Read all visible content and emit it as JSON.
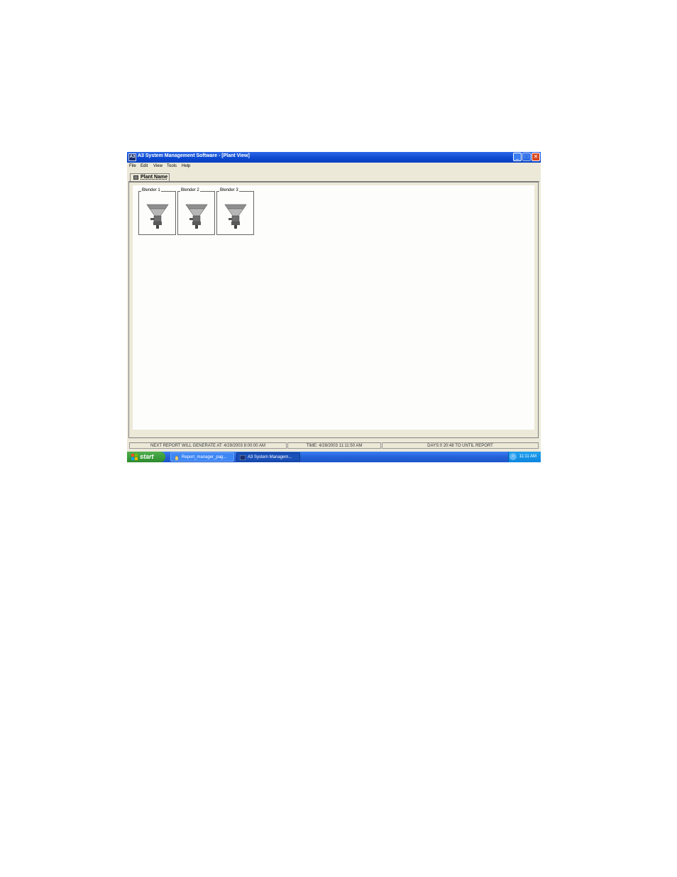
{
  "window": {
    "app_icon_text": "A3",
    "title": "A3 System Management Software - [Plant View]",
    "minimize_glyph": "_",
    "maximize_glyph": "□",
    "close_glyph": "✕"
  },
  "menu": [
    "File",
    "Edit",
    "View",
    "Tools",
    "Help"
  ],
  "tabs": [
    {
      "label": "Plant Name",
      "icon": "plant-icon"
    }
  ],
  "blenders": [
    {
      "label": "Blender 1",
      "icon": "blender-icon"
    },
    {
      "label": "Blender 2",
      "icon": "blender-icon"
    },
    {
      "label": "Blender 3",
      "icon": "blender-icon"
    }
  ],
  "status": {
    "next_report": "NEXT REPORT WILL GENERATE AT:  4/29/2003 8:00:00 AM",
    "time": "TIME:  4/28/2003 11:11:50 AM",
    "days": "DAYS:0  20:48 TO UNTIL REPORT"
  },
  "taskbar": {
    "start_label": "start",
    "buttons": [
      {
        "label": "Report_manager_pag...",
        "icon": "hand-icon"
      },
      {
        "label": "A3 System Managem...",
        "icon": "a3-app-icon"
      }
    ],
    "clock": "11:11 AM"
  },
  "colors": {
    "titlebar": "#0a47cf",
    "window_bg": "#ece9d8",
    "canvas_bg": "#fdfdfc",
    "taskbar": "#2461d8",
    "start": "#2c8a2c",
    "close": "#d9471e"
  }
}
